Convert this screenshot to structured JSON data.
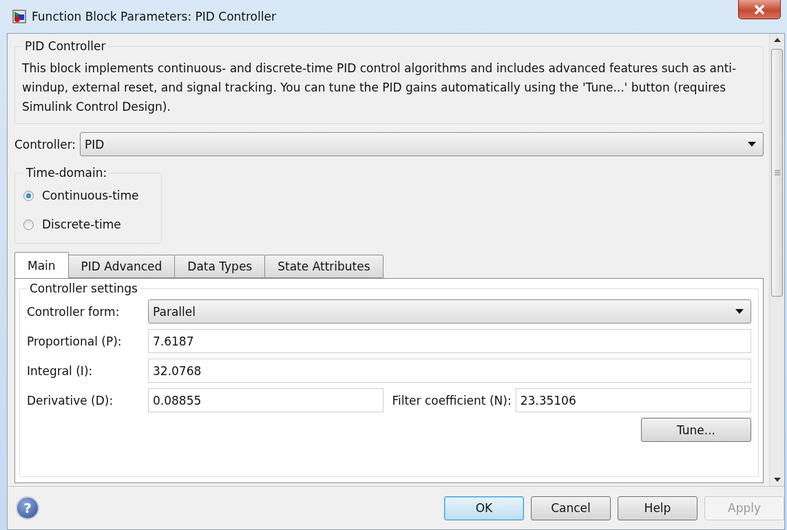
{
  "window": {
    "title": "Function Block Parameters: PID Controller"
  },
  "block_group": {
    "title": "PID Controller",
    "description": "This block implements continuous- and discrete-time PID control algorithms and includes advanced features such as anti-windup, external reset, and signal tracking. You can tune the PID gains automatically using the 'Tune...' button (requires Simulink Control Design)."
  },
  "controller": {
    "label": "Controller:",
    "value": "PID"
  },
  "time_domain": {
    "title": "Time-domain:",
    "options": [
      {
        "label": "Continuous-time",
        "selected": true
      },
      {
        "label": "Discrete-time",
        "selected": false
      }
    ]
  },
  "tabs": [
    {
      "label": "Main",
      "selected": true
    },
    {
      "label": "PID Advanced",
      "selected": false
    },
    {
      "label": "Data Types",
      "selected": false
    },
    {
      "label": "State Attributes",
      "selected": false
    }
  ],
  "settings": {
    "title": "Controller settings",
    "form": {
      "label": "Controller form:",
      "value": "Parallel"
    },
    "rows": [
      {
        "fields": [
          {
            "label": "Proportional (P):",
            "value": "7.6187"
          }
        ]
      },
      {
        "fields": [
          {
            "label": "Integral (I):",
            "value": "32.0768"
          }
        ]
      },
      {
        "fields": [
          {
            "label": "Derivative (D):",
            "value": "0.08855"
          },
          {
            "label": "Filter coefficient (N):",
            "value": "23.35106"
          }
        ]
      }
    ],
    "tune_button": "Tune..."
  },
  "help_button": {
    "label": "?"
  },
  "buttons": [
    {
      "label": "OK",
      "default": true,
      "disabled": false
    },
    {
      "label": "Cancel",
      "default": false,
      "disabled": false
    },
    {
      "label": "Help",
      "default": false,
      "disabled": false
    },
    {
      "label": "Apply",
      "default": false,
      "disabled": true
    }
  ]
}
